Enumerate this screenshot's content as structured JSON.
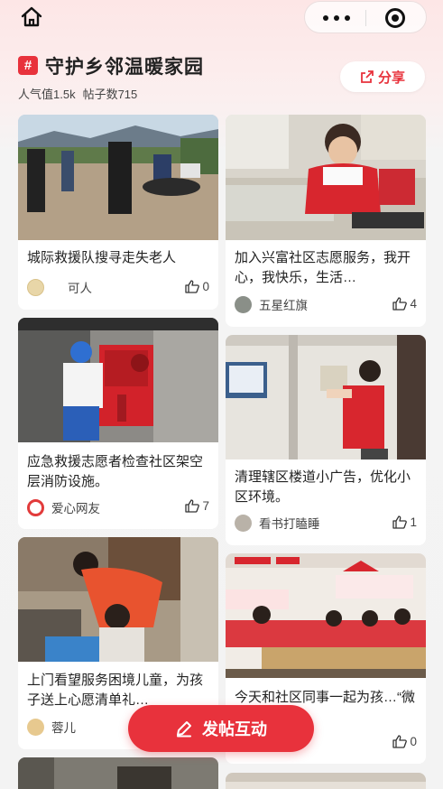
{
  "topbar": {
    "home_icon": "home-icon",
    "more_icon": "more-dots-icon",
    "scan_icon": "target-icon"
  },
  "topic": {
    "tag": "#",
    "title": "守护乡邻温暖家园",
    "popularity": "人气值1.5k",
    "posts": "帖子数715",
    "share_label": "分享",
    "share_icon": "share-icon"
  },
  "posts": [
    {
      "title": "城际救援队搜寻走失老人",
      "author": "可人",
      "likes": "0",
      "image": "rescue-team-photo"
    },
    {
      "title": "加入兴富社区志愿服务，我开心，我快乐，生活…",
      "author": "五星红旗",
      "likes": "4",
      "image": "volunteer-sewing-photo"
    },
    {
      "title": "应急救援志愿者检查社区架空层消防设施。",
      "author": "爱心网友",
      "likes": "7",
      "image": "fire-cabinet-photo"
    },
    {
      "title": "清理辖区楼道小广告，优化小区环境。",
      "author": "看书打瞌睡",
      "likes": "1",
      "image": "stairwell-cleaning-photo"
    },
    {
      "title": "上门看望服务困境儿童，为孩子送上心愿清单礼…",
      "author": "蓉儿",
      "likes": "",
      "image": "child-visit-photo"
    },
    {
      "title": "今天和社区同事一起为孩…“微光书简”暑…",
      "author": "",
      "likes": "0",
      "image": "community-activity-photo"
    }
  ],
  "fab": {
    "label": "发帖互动",
    "icon": "pen-icon"
  },
  "colors": {
    "accent": "#e8323c",
    "vest": "#d8262e",
    "background": "#f3f3f3"
  }
}
